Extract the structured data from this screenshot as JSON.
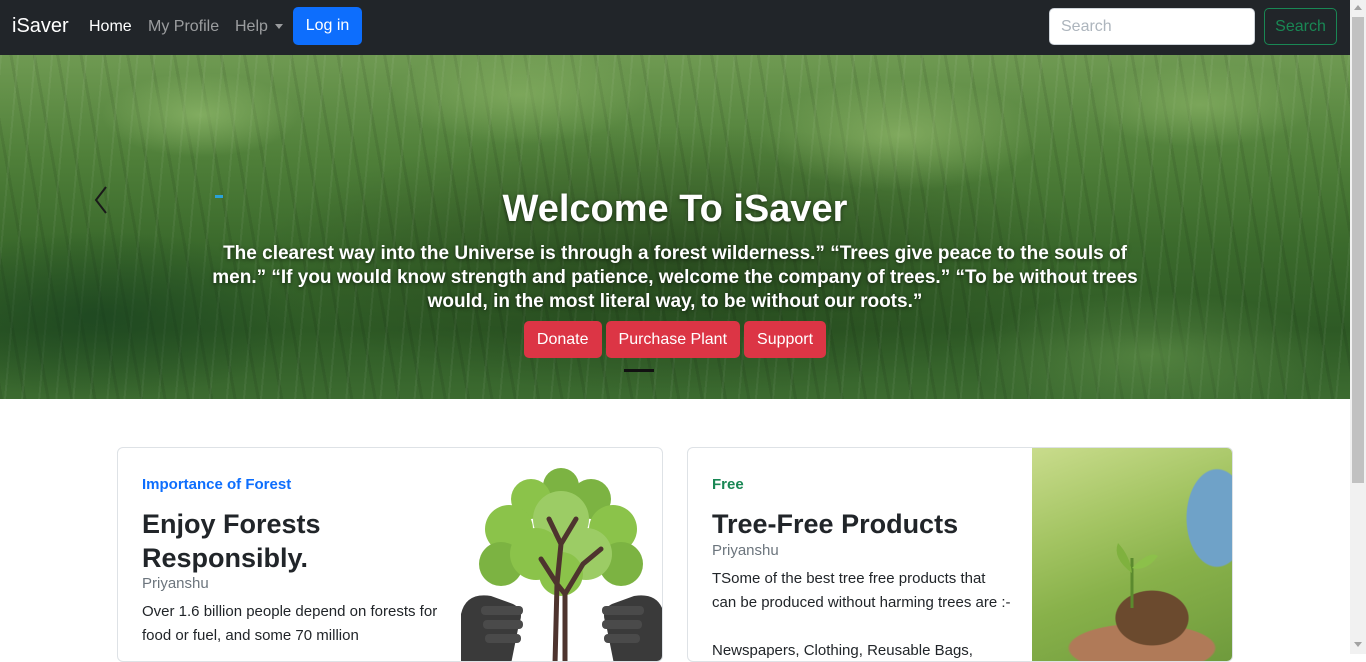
{
  "nav": {
    "brand": "iSaver",
    "links": [
      "Home",
      "My Profile",
      "Help"
    ],
    "login": "Log in",
    "search_placeholder": "Search",
    "search_button": "Search"
  },
  "hero": {
    "title": "Welcome To iSaver",
    "text": "The clearest way into the Universe is through a forest wilderness.” “Trees give peace to the souls of men.” “If you would know strength and patience, welcome the company of trees.” “To be without trees would, in the most literal way, to be without our roots.”",
    "buttons": [
      "Donate",
      "Purchase Plant",
      "Support"
    ]
  },
  "cards": [
    {
      "category": "Importance of Forest",
      "title": "Enjoy Forests Responsibly.",
      "author": "Priyanshu",
      "text": "Over 1.6 billion people depend on forests for food or fuel, and some 70 million"
    },
    {
      "category": "Free",
      "title": "Tree-Free Products",
      "author": "Priyanshu",
      "text": "TSome of the best tree free products that can be produced without harming trees are :-",
      "text2": "Newspapers, Clothing, Reusable Bags,"
    }
  ],
  "colors": {
    "navbar": "#212529",
    "primary": "#0d6efd",
    "success": "#198754",
    "danger": "#dc3545"
  }
}
